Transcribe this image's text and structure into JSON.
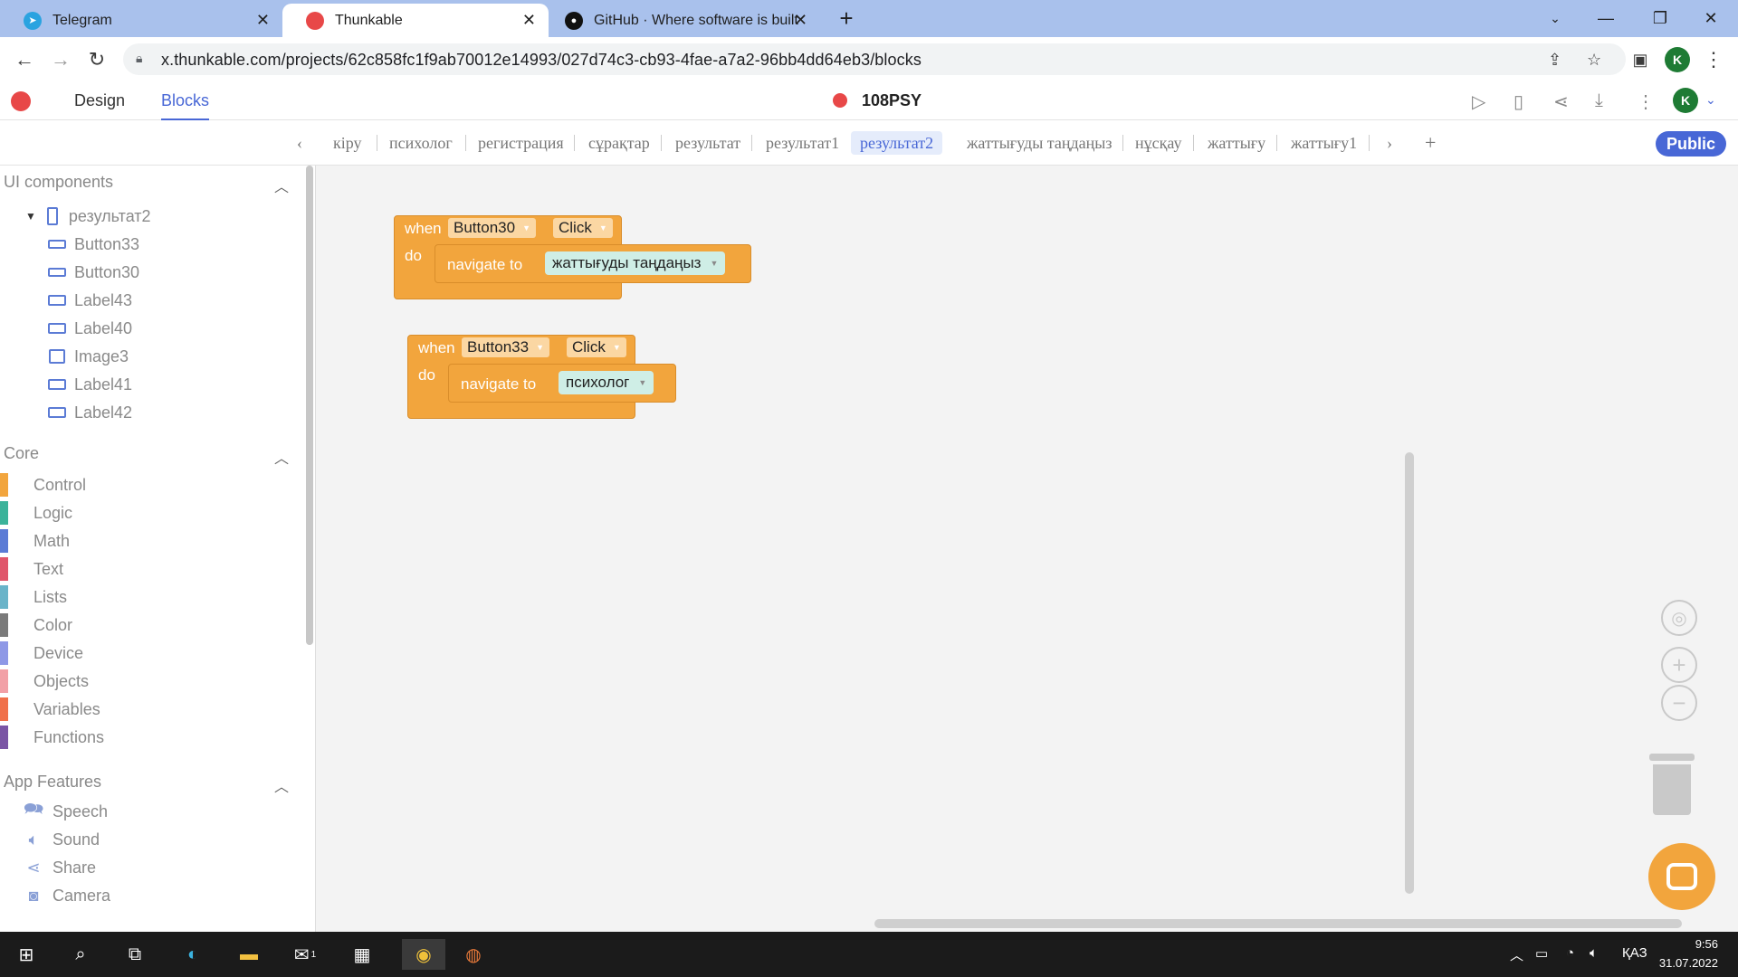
{
  "browser": {
    "tabs": [
      {
        "title": "Telegram",
        "icon": "telegram-icon",
        "color": "#2aa3e0"
      },
      {
        "title": "Thunkable",
        "icon": "thunkable-icon",
        "color": "#e84848"
      },
      {
        "title": "GitHub · Where software is built",
        "icon": "github-icon",
        "color": "#111111"
      }
    ],
    "new_tab": "+",
    "url": "x.thunkable.com/projects/62c858fc1f9ab70012e14993/027d74c3-cb93-4fae-a7a2-96bb4dd64eb3/blocks",
    "profile_initial": "K"
  },
  "app": {
    "tabs": {
      "design": "Design",
      "blocks": "Blocks"
    },
    "project_name": "108PSY",
    "profile_initial": "K"
  },
  "screens": {
    "items": [
      "кіру",
      "психолог",
      "регистрация",
      "сұрақтар",
      "результат",
      "результат1",
      "результат2",
      "жаттығуды таңдаңыз",
      "нұсқау",
      "жаттығу",
      "жаттығу1"
    ],
    "active": "результат2",
    "public_label": "Public"
  },
  "sidebar": {
    "ui_components": {
      "title": "UI components",
      "screen": "результат2",
      "items": [
        {
          "label": "Button33",
          "icon": "button-icon"
        },
        {
          "label": "Button30",
          "icon": "button-icon"
        },
        {
          "label": "Label43",
          "icon": "label-icon"
        },
        {
          "label": "Label40",
          "icon": "label-icon"
        },
        {
          "label": "Image3",
          "icon": "image-icon"
        },
        {
          "label": "Label41",
          "icon": "label-icon"
        },
        {
          "label": "Label42",
          "icon": "label-icon"
        }
      ]
    },
    "core": {
      "title": "Core",
      "items": [
        {
          "label": "Control",
          "color": "#f2a53d"
        },
        {
          "label": "Logic",
          "color": "#3bb39a"
        },
        {
          "label": "Math",
          "color": "#5b7bd5"
        },
        {
          "label": "Text",
          "color": "#e0566b"
        },
        {
          "label": "Lists",
          "color": "#6ab4c9"
        },
        {
          "label": "Color",
          "color": "#7a7a7a"
        },
        {
          "label": "Device",
          "color": "#8e98e6"
        },
        {
          "label": "Objects",
          "color": "#f2a0a6"
        },
        {
          "label": "Variables",
          "color": "#f0704a"
        },
        {
          "label": "Functions",
          "color": "#7a55a5"
        }
      ]
    },
    "app_features": {
      "title": "App Features",
      "items": [
        {
          "label": "Speech",
          "icon": "speech-icon"
        },
        {
          "label": "Sound",
          "icon": "sound-icon"
        },
        {
          "label": "Share",
          "icon": "share-icon"
        },
        {
          "label": "Camera",
          "icon": "camera-icon"
        }
      ]
    }
  },
  "blocks": [
    {
      "when": "when",
      "component": "Button30",
      "event": "Click",
      "do": "do",
      "action": "navigate to",
      "target": "жаттығуды таңдаңыз"
    },
    {
      "when": "when",
      "component": "Button33",
      "event": "Click",
      "do": "do",
      "action": "navigate to",
      "target": "психолог"
    }
  ],
  "taskbar": {
    "language": "ҚАЗ",
    "time": "9:56",
    "date": "31.07.2022",
    "mail_badge": "1"
  }
}
